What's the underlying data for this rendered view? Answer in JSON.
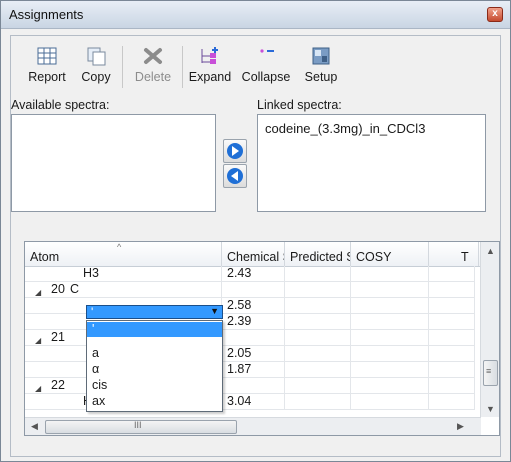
{
  "window": {
    "title": "Assignments",
    "close_glyph": "x"
  },
  "toolbar": {
    "buttons": [
      {
        "label": "Report",
        "icon": "report-icon",
        "enabled": true
      },
      {
        "label": "Copy",
        "icon": "copy-icon",
        "enabled": true
      },
      {
        "label": "Delete",
        "icon": "delete-icon",
        "enabled": false
      },
      {
        "label": "Expand",
        "icon": "expand-icon",
        "enabled": true
      },
      {
        "label": "Collapse",
        "icon": "collapse-icon",
        "enabled": true
      },
      {
        "label": "Setup",
        "icon": "setup-icon",
        "enabled": true
      }
    ]
  },
  "spectra": {
    "available_label": "Available spectra:",
    "linked_label": "Linked spectra:",
    "linked_items": [
      "codeine_(3.3mg)_in_CDCl3"
    ]
  },
  "grid": {
    "columns": [
      "Atom",
      "Chemical Sl",
      "Predicted S",
      "COSY",
      "T"
    ],
    "rows": [
      {
        "atom": "H3",
        "expander": "",
        "shift": "2.43"
      },
      {
        "atom": "C",
        "expander": "20",
        "shift": ""
      },
      {
        "atom": "",
        "expander": "",
        "shift": "2.58"
      },
      {
        "atom": "",
        "expander": "",
        "shift": "2.39"
      },
      {
        "atom": "",
        "expander": "21",
        "shift": ""
      },
      {
        "atom": "",
        "expander": "",
        "shift": "2.05"
      },
      {
        "atom": "",
        "expander": "",
        "shift": "1.87"
      },
      {
        "atom": "",
        "expander": "22",
        "shift": ""
      },
      {
        "atom": "H'",
        "expander": "",
        "shift": "3.04"
      }
    ],
    "hscroll_glyph": "III"
  },
  "combo": {
    "value": "'",
    "options": [
      "'",
      "a",
      "α",
      "cis",
      "ax"
    ],
    "selected_index": 0
  },
  "colors": {
    "selection": "#3399ff",
    "arrow_blue": "#1f6fd6"
  }
}
